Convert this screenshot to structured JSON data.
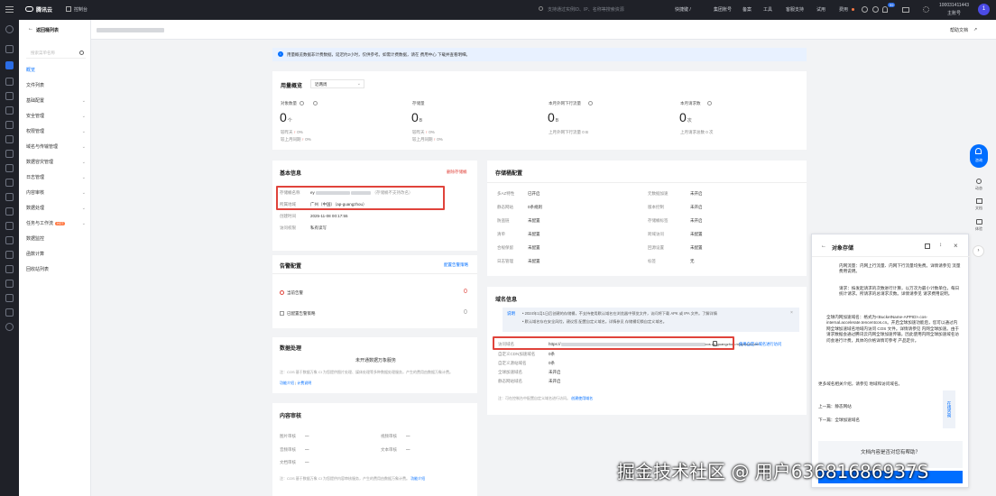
{
  "topbar": {
    "brand": "腾讯云",
    "console": "控制台",
    "search_placeholder": "支持通过实例ID、IP、名称等搜索资源",
    "group": "快捷键 /",
    "items": [
      "集团账号",
      "备案",
      "工具",
      "客服支持",
      "试用",
      "费用"
    ],
    "badge": "99",
    "account_id": "100031411443",
    "account_role": "主账号",
    "avatar": "1"
  },
  "sidenav": {
    "back": "返回桶列表",
    "search_placeholder": "搜索菜单名称",
    "items": [
      {
        "label": "概览",
        "active": true,
        "arrow": false,
        "hot": false
      },
      {
        "label": "文件列表",
        "active": false,
        "arrow": false,
        "hot": false
      },
      {
        "label": "基础配置",
        "active": false,
        "arrow": true,
        "hot": false
      },
      {
        "label": "安全管理",
        "active": false,
        "arrow": true,
        "hot": false
      },
      {
        "label": "权限管理",
        "active": false,
        "arrow": true,
        "hot": false
      },
      {
        "label": "域名与传输管理",
        "active": false,
        "arrow": true,
        "hot": false
      },
      {
        "label": "数据容灾管理",
        "active": false,
        "arrow": true,
        "hot": false
      },
      {
        "label": "日志管理",
        "active": false,
        "arrow": true,
        "hot": false
      },
      {
        "label": "内容审核",
        "active": false,
        "arrow": true,
        "hot": false
      },
      {
        "label": "数据处理",
        "active": false,
        "arrow": true,
        "hot": false
      },
      {
        "label": "任务与工作流",
        "active": false,
        "arrow": true,
        "hot": true
      },
      {
        "label": "数据监控",
        "active": false,
        "arrow": false,
        "hot": false
      },
      {
        "label": "函数计算",
        "active": false,
        "arrow": false,
        "hot": false
      },
      {
        "label": "回收站列表",
        "active": false,
        "arrow": false,
        "hot": false
      }
    ],
    "hot_label": "HOT"
  },
  "header": {
    "help": "帮助文档"
  },
  "notice": {
    "text": "用量概览数据非计费数据，延迟约2小时，仅供参考。如需计费数据，请在 费用中心 下载并查看明细。"
  },
  "usage": {
    "title": "用量概览",
    "period": "近两周",
    "metrics": [
      {
        "label": "对象数量",
        "value": "0",
        "unit": "个",
        "sub1": "较昨天",
        "sub1v": "0%",
        "sub2": "较上月同期",
        "sub2v": "0%"
      },
      {
        "label": "存储量",
        "value": "0",
        "unit": "B",
        "sub1": "较昨天",
        "sub1v": "0%",
        "sub2": "较上月同期",
        "sub2v": "0%"
      },
      {
        "label": "本月外网下行流量",
        "value": "0",
        "unit": "B",
        "sub1": "上月外网下行流量",
        "sub1v": "0 B",
        "sub2": "",
        "sub2v": ""
      },
      {
        "label": "本月请求数",
        "value": "0",
        "unit": "次",
        "sub1": "上月请求总数",
        "sub1v": "0 次",
        "sub2": "",
        "sub2v": ""
      }
    ]
  },
  "basic": {
    "title": "基本信息",
    "delete": "删除存储桶",
    "rows": [
      {
        "label": "存储桶名称",
        "value": "ey",
        "tail": "（存储桶不支持改名）"
      },
      {
        "label": "所属地域",
        "value": "广州（中国）（ap-guangzhou）",
        "tail": ""
      },
      {
        "label": "创建时间",
        "value": "2025-11-08 00:17:55",
        "tail": ""
      },
      {
        "label": "访问权限",
        "value": "私有读写",
        "tail": ""
      }
    ]
  },
  "bucketcfg": {
    "title": "存储桶配置",
    "left": [
      {
        "label": "多AZ特性",
        "value": "已开启"
      },
      {
        "label": "静态网站",
        "value": "0条规则"
      },
      {
        "label": "防盗链",
        "value": "未配置"
      },
      {
        "label": "清单",
        "value": "未配置"
      },
      {
        "label": "合规保留",
        "value": "未配置"
      },
      {
        "label": "日志管理",
        "value": "未配置"
      }
    ],
    "right": [
      {
        "label": "元数据加速",
        "value": "未开启"
      },
      {
        "label": "版本控制",
        "value": "未开启"
      },
      {
        "label": "存储桶标签",
        "value": "未开启"
      },
      {
        "label": "跨域访问",
        "value": "未配置"
      },
      {
        "label": "回源设置",
        "value": "未配置"
      },
      {
        "label": "标签",
        "value": "无"
      }
    ]
  },
  "alarm": {
    "title": "告警配置",
    "action": "配置告警策略",
    "rows": [
      {
        "label": "当前告警",
        "value": "0"
      },
      {
        "label": "已配置告警策略",
        "value": "0"
      }
    ]
  },
  "dataproc": {
    "title": "数据处理",
    "service": "未开通数据万象服务",
    "desc": "注：COS 基于数据万象 CI 为您提供图片处理、媒体处理等多种数据处理服务，产生的费用由数据万象计费。",
    "link1": "功能介绍",
    "link2": "计费说明"
  },
  "audit": {
    "title": "内容审核",
    "items": [
      {
        "label": "图片审核",
        "value": "—"
      },
      {
        "label": "视频审核",
        "value": "—"
      },
      {
        "label": "音频审核",
        "value": "—"
      },
      {
        "label": "文本审核",
        "value": "—"
      },
      {
        "label": "文档审核",
        "value": "—"
      }
    ],
    "note": "注：COS 基于数据万象 CI 为您提供内容审核服务，产生的费用由数据万象计费。",
    "note_link": "功能介绍"
  },
  "domain": {
    "title": "域名信息",
    "tip_tag": "说明",
    "tip1": "• 2024年1月1日后创建的存储桶，不支持使用默认域名在浏览器中预览文件，访问将下载 APK 或 IPA 文件。了解详情",
    "tip2": "• 默认域名存在安全风险，建议您 配置自定义域名。详情参见 存储桶切换自定义域名。",
    "rows": [
      {
        "label": "访问域名",
        "value": "https://",
        "suffix": "cos.ap-guangzhou.myqcloud.com"
      },
      {
        "label": "自定义CDN加速域名",
        "value": "0条"
      },
      {
        "label": "自定义源站域名",
        "value": "0条"
      },
      {
        "label": "全球加速域名",
        "value": "未开启"
      },
      {
        "label": "静态网站域名",
        "value": "未开启"
      }
    ],
    "copy": "复制",
    "custom": "使用自定义域名进行访问",
    "footnote": "注：可在控制台中配置自定义域名进行访问。",
    "footnote_link": "创建使用域名"
  },
  "panel": {
    "title": "对象存储",
    "paragraphs": [
      "内网流量：内网上行流量、内网下行流量均免费。详情请参见 流量费用说明。",
      "请求：按发起请求的次数进行计算，以万次为最小计数单位，每日统计请求。所请求的总请求次数。详情请参见 请求费用说明。",
      "全球内网加速域名：格式为<BucketName-APPID>.cos-internal.accelerate.tencentcos.cn。开启全球加速功能后，您可以通过内网全球加速域名地域内访问 COS 文件。详情请参见 内网全球加速。由于请求数据会通过腾讯云内网全球加速传输，因此使用内网全球加速域名访问会进行计费，具体的价格详情可参考 产品定价。"
    ],
    "more": "更多域名相关介绍，请参见 地域和访问域名。",
    "prev": "上一篇：静态网站",
    "next": "下一篇：全球加速域名",
    "feedback": "文档内容是否对您有帮助？",
    "feedback_side": "在线咨询"
  },
  "rightrail": {
    "items": [
      "咨询",
      "动态",
      "文档",
      "体验"
    ]
  },
  "watermark": "掘金技术社区 @ 用户63681686937S"
}
